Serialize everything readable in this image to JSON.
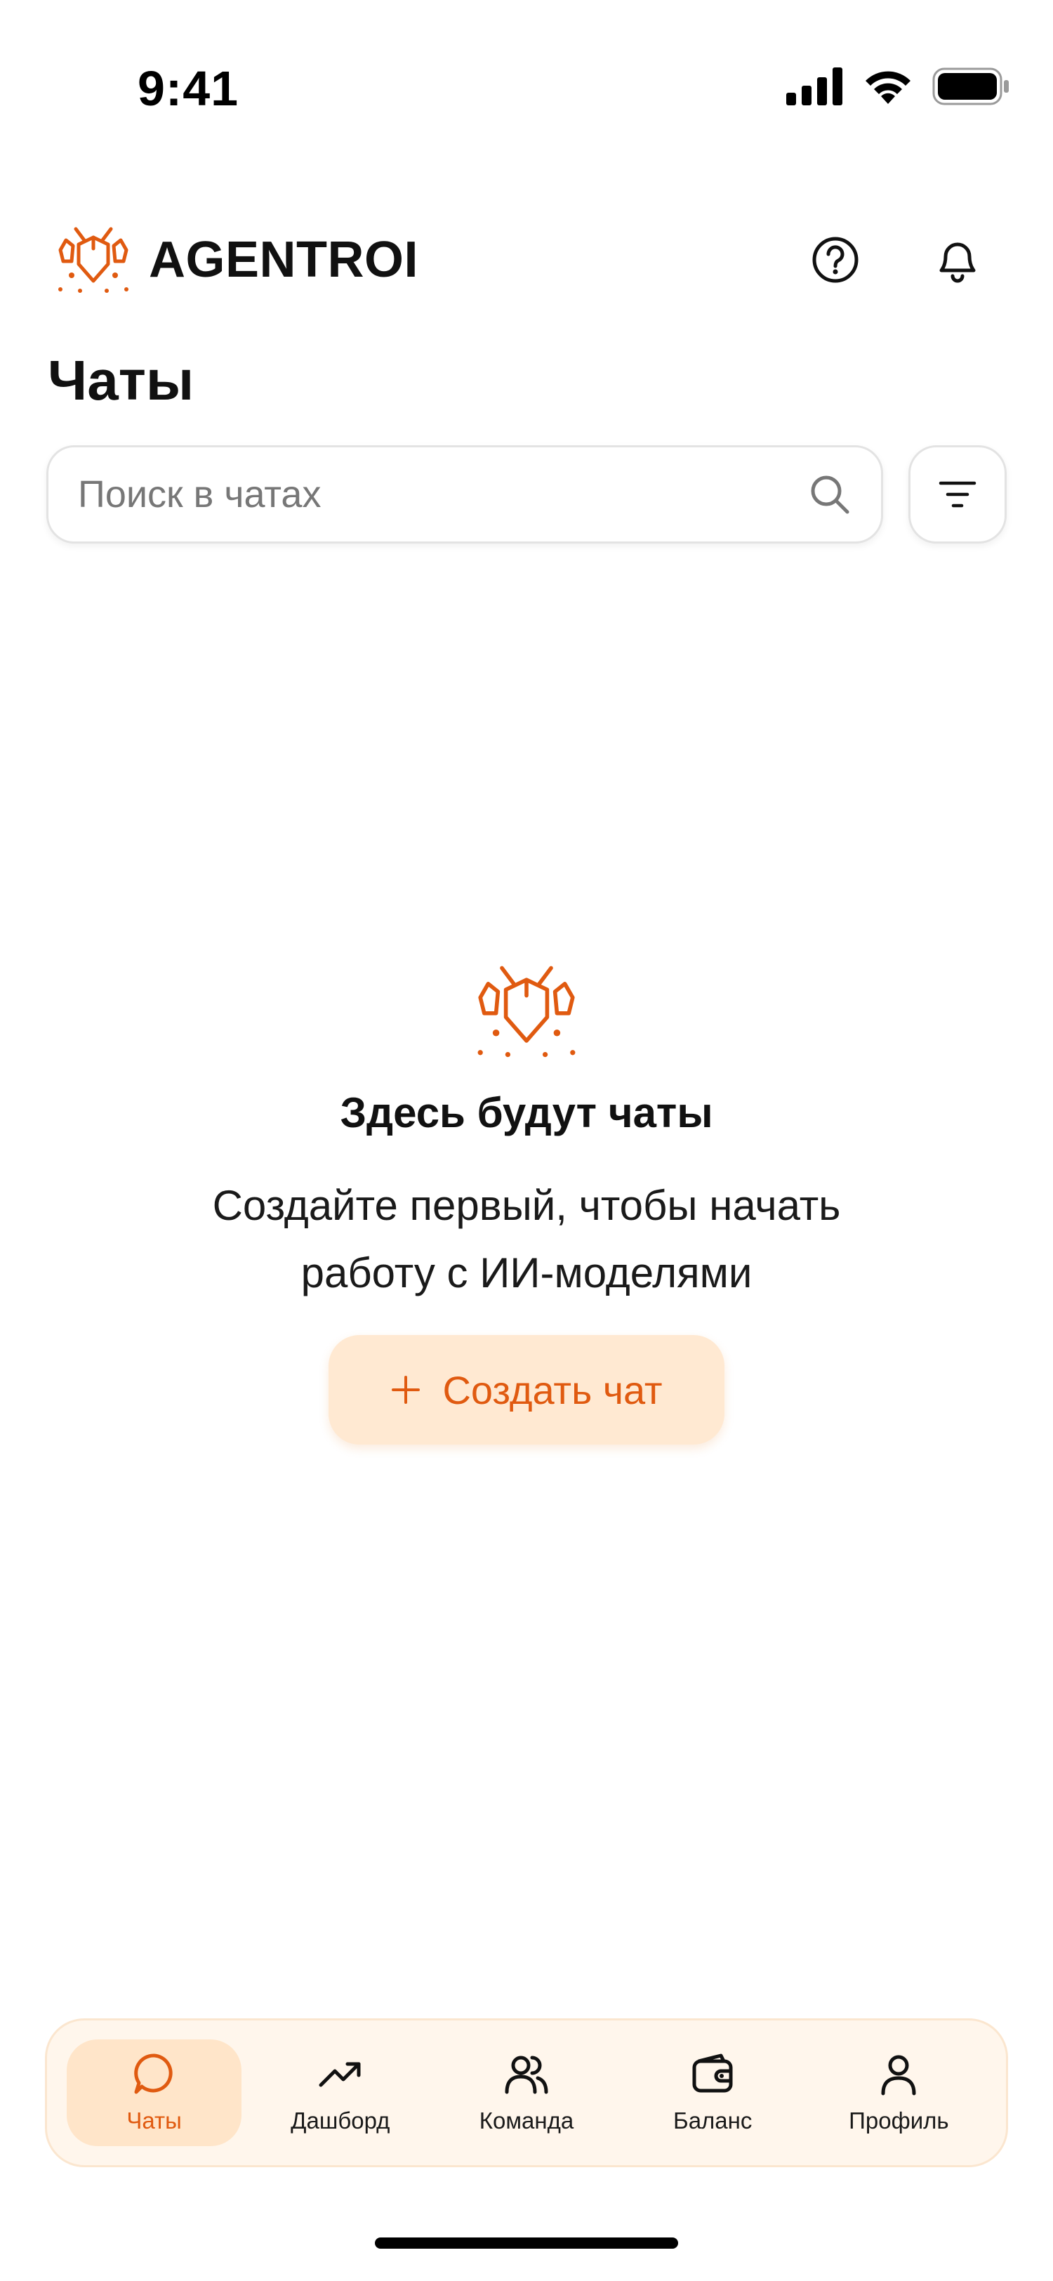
{
  "status_bar": {
    "time": "9:41"
  },
  "header": {
    "app_name": "AGENTROI"
  },
  "page": {
    "title": "Чаты"
  },
  "search": {
    "placeholder": "Поиск в чатах",
    "value": ""
  },
  "empty_state": {
    "title": "Здесь будут чаты",
    "subtitle": "Создайте первый, чтобы начать работу с ИИ-моделями",
    "button_label": "Создать чат"
  },
  "nav": {
    "items": [
      {
        "label": "Чаты",
        "icon": "chat-icon",
        "active": true
      },
      {
        "label": "Дашборд",
        "icon": "trending-up-icon",
        "active": false
      },
      {
        "label": "Команда",
        "icon": "users-icon",
        "active": false
      },
      {
        "label": "Баланс",
        "icon": "wallet-icon",
        "active": false
      },
      {
        "label": "Профиль",
        "icon": "user-icon",
        "active": false
      }
    ]
  },
  "colors": {
    "accent": "#e05a10",
    "accent_soft": "#ffe9d2",
    "nav_bg": "#fff6ec"
  }
}
